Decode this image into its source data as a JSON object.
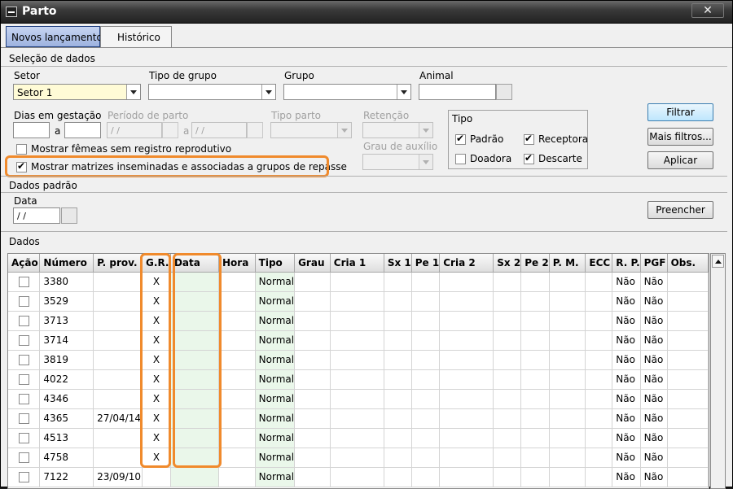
{
  "window": {
    "title": "Parto"
  },
  "tabs": [
    {
      "label": "Novos lançamentos",
      "active": true
    },
    {
      "label": "Histórico",
      "active": false
    }
  ],
  "selecao": {
    "section_label": "Seleção de dados",
    "setor_label": "Setor",
    "setor_value": "Setor 1",
    "tipo_grupo_label": "Tipo de grupo",
    "grupo_label": "Grupo",
    "animal_label": "Animal",
    "dias_label": "Dias em gestação",
    "a1": "a",
    "periodo_label": "Período de parto",
    "periodo_from": " /  /",
    "a2": "a",
    "periodo_to": " /  /",
    "tipo_parto_label": "Tipo parto",
    "retencao_label": "Retenção",
    "grau_label": "Grau de auxílio",
    "chk_sem_registro": "Mostrar fêmeas sem registro reprodutivo",
    "chk_inseminadas": "Mostrar matrizes inseminadas e associadas a grupos de repasse"
  },
  "tipo_group": {
    "label": "Tipo",
    "padrao": "Padrão",
    "receptora": "Receptora",
    "doadora": "Doadora",
    "descarte": "Descarte"
  },
  "buttons": {
    "filtrar": "Filtrar",
    "mais_filtros": "Mais filtros...",
    "aplicar": "Aplicar",
    "preencher": "Preencher"
  },
  "dados_padrao": {
    "section_label": "Dados padrão",
    "data_label": "Data",
    "data_value": " /  /"
  },
  "dados": {
    "section_label": "Dados",
    "columns": [
      "Ação",
      "Número",
      "P. prov.",
      "G.R.",
      "Data",
      "Hora",
      "Tipo",
      "Grau",
      "Cria 1",
      "Sx 1",
      "Pe 1",
      "Cria 2",
      "Sx 2",
      "Pe 2",
      "P. M.",
      "ECC",
      "R. P.",
      "PGF",
      "Obs."
    ],
    "rows": [
      {
        "numero": "3380",
        "pprov": "",
        "gr": "X",
        "tipo": "Normal",
        "rp": "Não",
        "pgf": "Não"
      },
      {
        "numero": "3529",
        "pprov": "",
        "gr": "X",
        "tipo": "Normal",
        "rp": "Não",
        "pgf": "Não"
      },
      {
        "numero": "3713",
        "pprov": "",
        "gr": "X",
        "tipo": "Normal",
        "rp": "Não",
        "pgf": "Não"
      },
      {
        "numero": "3714",
        "pprov": "",
        "gr": "X",
        "tipo": "Normal",
        "rp": "Não",
        "pgf": "Não"
      },
      {
        "numero": "3819",
        "pprov": "",
        "gr": "X",
        "tipo": "Normal",
        "rp": "Não",
        "pgf": "Não"
      },
      {
        "numero": "4022",
        "pprov": "",
        "gr": "X",
        "tipo": "Normal",
        "rp": "Não",
        "pgf": "Não"
      },
      {
        "numero": "4346",
        "pprov": "",
        "gr": "X",
        "tipo": "Normal",
        "rp": "Não",
        "pgf": "Não"
      },
      {
        "numero": "4365",
        "pprov": "27/04/14",
        "gr": "X",
        "tipo": "Normal",
        "rp": "Não",
        "pgf": "Não"
      },
      {
        "numero": "4513",
        "pprov": "",
        "gr": "X",
        "tipo": "Normal",
        "rp": "Não",
        "pgf": "Não"
      },
      {
        "numero": "4758",
        "pprov": "",
        "gr": "X",
        "tipo": "Normal",
        "rp": "Não",
        "pgf": "Não"
      },
      {
        "numero": "7122",
        "pprov": "23/09/10",
        "gr": "",
        "tipo": "Normal",
        "rp": "Não",
        "pgf": "Não"
      }
    ]
  },
  "colors": {
    "highlight": "#f08a2c",
    "green_cell": "#eaf7ea",
    "tab_active": "#9db2df"
  },
  "icons": {
    "close": "close-icon",
    "menu": "window-menu-icon",
    "dropdown": "chevron-down-icon",
    "scroll_up": "scroll-up-icon"
  }
}
